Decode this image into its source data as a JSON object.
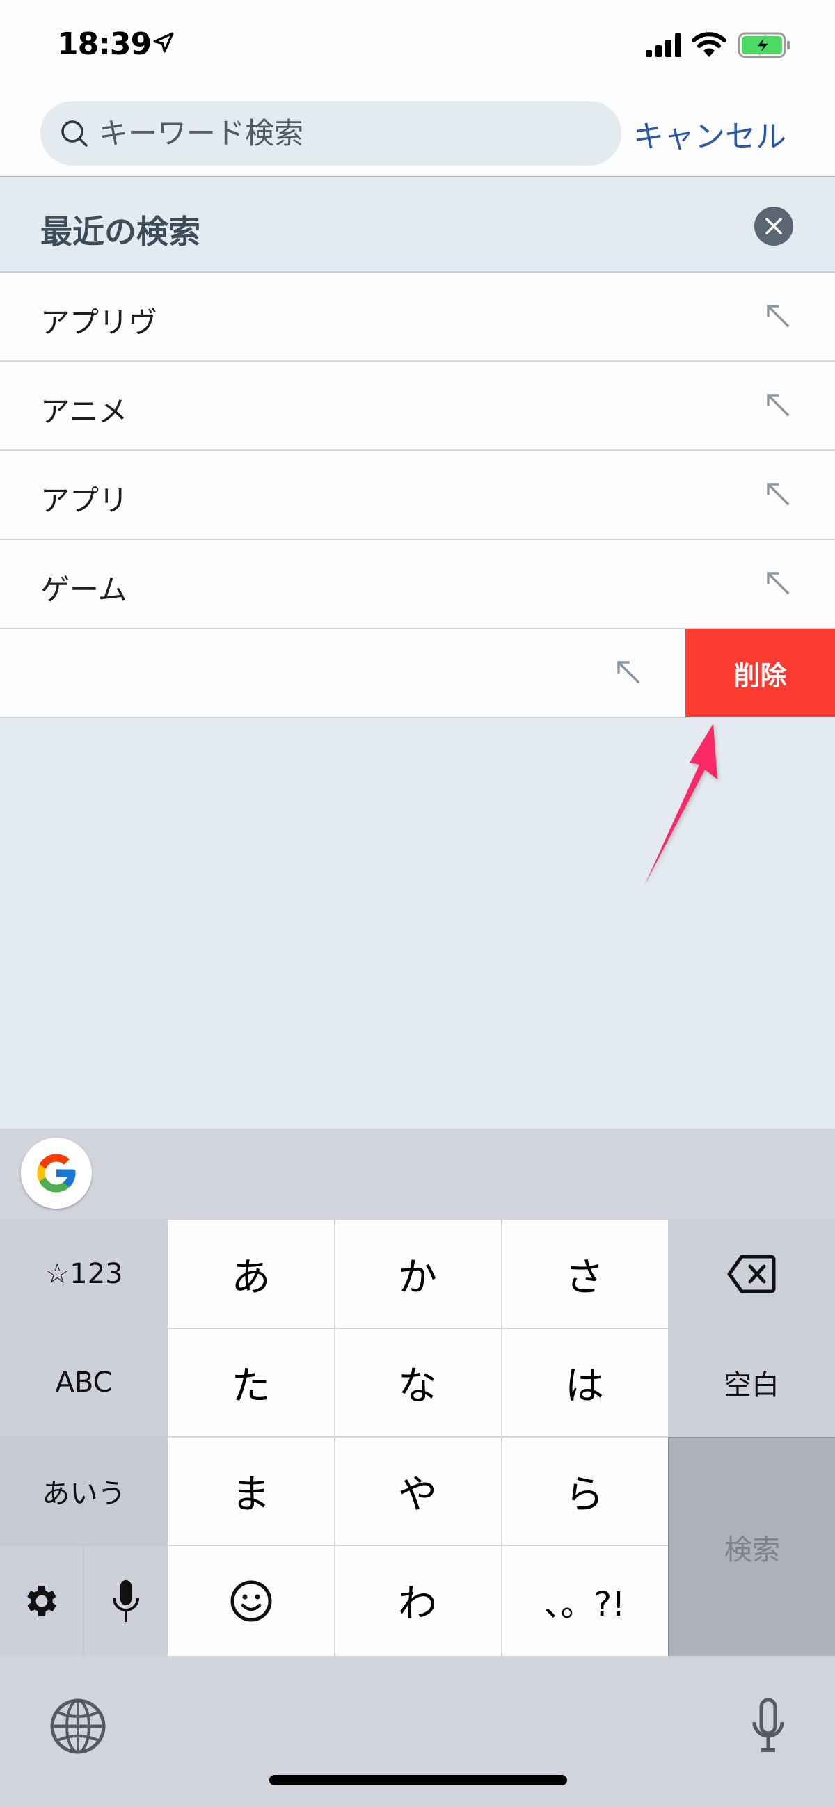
{
  "status_bar": {
    "time": "18:39",
    "icons": [
      "location-arrow-icon",
      "signal-icon",
      "wifi-icon",
      "battery-charging-icon"
    ],
    "battery_color": "#4cd964"
  },
  "search": {
    "placeholder": "キーワード検索",
    "value": "",
    "cancel_label": "キャンセル"
  },
  "recent": {
    "title": "最近の検索",
    "clear_icon": "clear-circle-icon",
    "items": [
      {
        "label": "アプリヴ"
      },
      {
        "label": "アニメ"
      },
      {
        "label": "アプリ"
      },
      {
        "label": "ゲーム"
      },
      {
        "label": "",
        "swiped": true
      }
    ],
    "delete_label": "削除",
    "delete_color": "#fe3b30"
  },
  "annotation": {
    "arrow_color": "#fb2a66"
  },
  "keyboard": {
    "google_icon": "google-g-icon",
    "rows": [
      [
        "☆123",
        "あ",
        "か",
        "さ",
        "⌫"
      ],
      [
        "ABC",
        "た",
        "な",
        "は",
        "空白"
      ],
      [
        "あいう",
        "ま",
        "や",
        "ら",
        "検索"
      ],
      [
        "⚙",
        "🎤",
        "☺",
        "わ",
        "、。?!"
      ]
    ],
    "keys": {
      "symbols": "☆123",
      "a": "あ",
      "ka": "か",
      "sa": "さ",
      "abc": "ABC",
      "ta": "た",
      "na": "な",
      "ha": "は",
      "space": "空白",
      "kana": "あいう",
      "ma": "ま",
      "ya": "や",
      "ra": "ら",
      "search": "検索",
      "wa": "わ",
      "punct": "、。?!"
    }
  }
}
